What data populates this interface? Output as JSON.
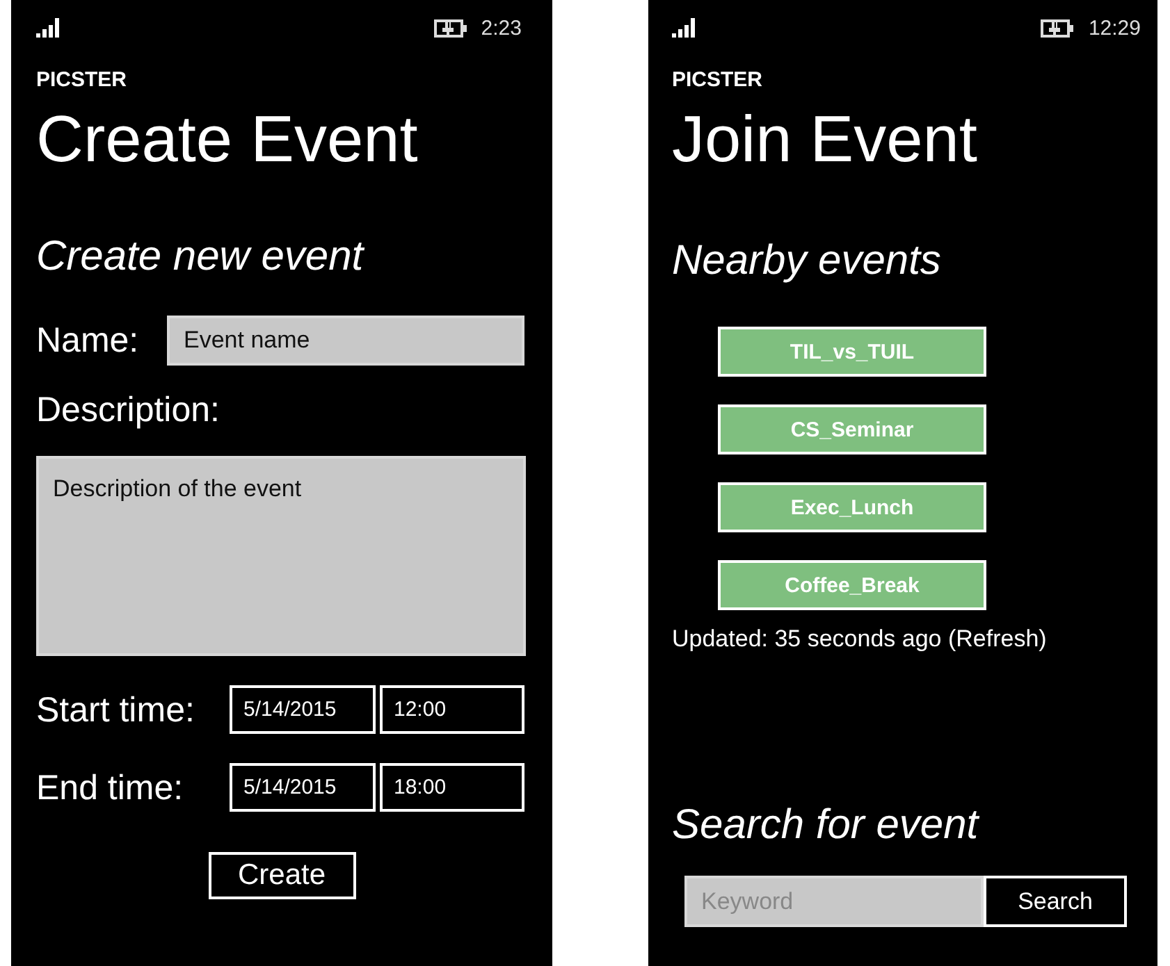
{
  "screens": [
    {
      "kind": "create",
      "status_bar": {
        "time": "2:23"
      },
      "app_name": "PICSTER",
      "title": "Create Event",
      "heading": "Create new event",
      "name_field": {
        "label": "Name:",
        "value": "Event name"
      },
      "description_field": {
        "label": "Description:",
        "value": "Description of the event"
      },
      "time_rows": [
        {
          "label": "Start time:",
          "date": "5/14/2015",
          "time": "12:00"
        },
        {
          "label": "End time:",
          "date": "5/14/2015",
          "time": "18:00"
        }
      ],
      "button": "Create"
    },
    {
      "kind": "join",
      "status_bar": {
        "time": "12:29"
      },
      "app_name": "PICSTER",
      "title": "Join Event",
      "heading": "Nearby events",
      "events": [
        "TIL_vs_TUIL",
        "CS_Seminar",
        "Exec_Lunch",
        "Coffee_Break"
      ],
      "updated": "Updated: 35 seconds ago (Refresh)",
      "search": {
        "heading": "Search for event",
        "placeholder": "Keyword",
        "button": "Search"
      }
    }
  ]
}
